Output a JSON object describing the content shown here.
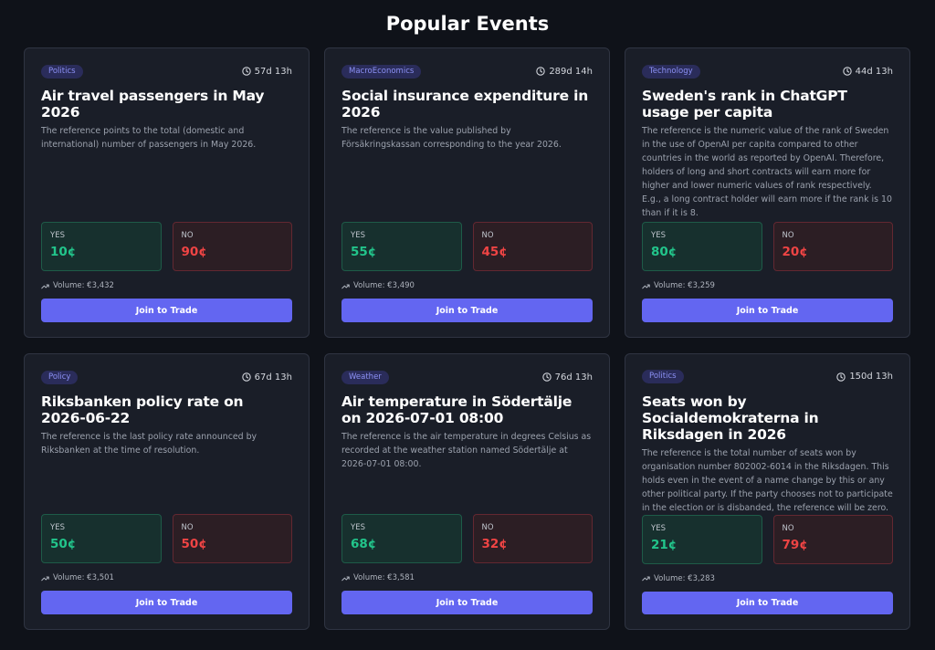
{
  "page": {
    "title": "Popular Events"
  },
  "colors": {
    "background": "#0f1219",
    "card": "#1a1e28",
    "accent": "#6366f1",
    "yes": "#22c58b",
    "no": "#ef4444",
    "badge_text": "#8c91f5"
  },
  "icons": {
    "time": "clock-icon",
    "volume": "trending-up-icon"
  },
  "cards": [
    {
      "category": "Politics",
      "time_left": "57d 13h",
      "title": "Air travel passengers in May 2026",
      "description": "The reference points to the total (domestic and international) number of passengers in May 2026.",
      "yes_label": "YES",
      "yes_price": "10¢",
      "no_label": "NO",
      "no_price": "90¢",
      "volume": "Volume: €3,432",
      "button_label": "Join to Trade"
    },
    {
      "category": "MacroEconomics",
      "time_left": "289d 14h",
      "title": "Social insurance expenditure in 2026",
      "description": "The reference is the value published by Försäkringskassan corresponding to the year 2026.",
      "yes_label": "YES",
      "yes_price": "55¢",
      "no_label": "NO",
      "no_price": "45¢",
      "volume": "Volume: €3,490",
      "button_label": "Join to Trade"
    },
    {
      "category": "Technology",
      "time_left": "44d 13h",
      "title": "Sweden's rank in ChatGPT usage per capita",
      "description": "The reference is the numeric value of the rank of Sweden in the use of OpenAI per capita compared to other countries in the world as reported by OpenAI. Therefore, holders of long and short contracts will earn more for higher and lower numeric values of rank respectively. E.g., a long contract holder will earn more if the rank is 10 than if it is 8.",
      "yes_label": "YES",
      "yes_price": "80¢",
      "no_label": "NO",
      "no_price": "20¢",
      "volume": "Volume: €3,259",
      "button_label": "Join to Trade"
    },
    {
      "category": "Policy",
      "time_left": "67d 13h",
      "title": "Riksbanken policy rate on 2026-06-22",
      "description": "The reference is the last policy rate announced by Riksbanken at the time of resolution.",
      "yes_label": "YES",
      "yes_price": "50¢",
      "no_label": "NO",
      "no_price": "50¢",
      "volume": "Volume: €3,501",
      "button_label": "Join to Trade"
    },
    {
      "category": "Weather",
      "time_left": "76d 13h",
      "title": "Air temperature in Södertälje on 2026-07-01 08:00",
      "description": "The reference is the air temperature in degrees Celsius as recorded at the weather station named Södertälje at 2026-07-01 08:00.",
      "yes_label": "YES",
      "yes_price": "68¢",
      "no_label": "NO",
      "no_price": "32¢",
      "volume": "Volume: €3,581",
      "button_label": "Join to Trade"
    },
    {
      "category": "Politics",
      "time_left": "150d 13h",
      "title": "Seats won by Socialdemokraterna in Riksdagen in 2026",
      "description": "The reference is the total number of seats won by organisation number 802002-6014 in the Riksdagen. This holds even in the event of a name change by this or any other political party. If the party chooses not to participate in the election or is disbanded, the reference will be zero.",
      "yes_label": "YES",
      "yes_price": "21¢",
      "no_label": "NO",
      "no_price": "79¢",
      "volume": "Volume: €3,283",
      "button_label": "Join to Trade"
    }
  ]
}
